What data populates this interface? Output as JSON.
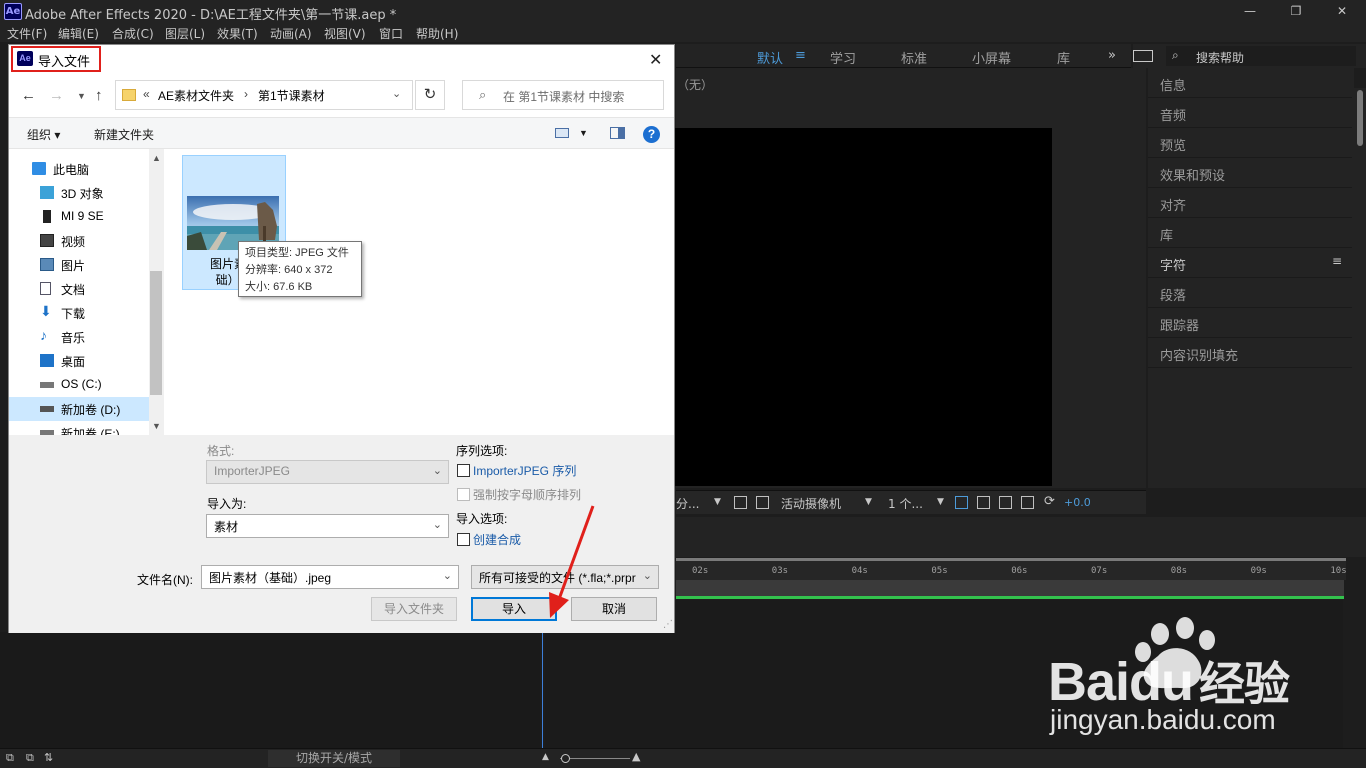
{
  "app": {
    "title": "Adobe After Effects 2020 - D:\\AE工程文件夹\\第一节课.aep *",
    "logo": "Ae",
    "menu": [
      "文件(F)",
      "编辑(E)",
      "合成(C)",
      "图层(L)",
      "效果(T)",
      "动画(A)",
      "视图(V)",
      "窗口",
      "帮助(H)"
    ],
    "workspaces": [
      "默认",
      "学习",
      "标准",
      "小屏幕",
      "库"
    ],
    "more_glyph": "»",
    "search_help": "搜索帮助",
    "viewer_label": "（无）",
    "viewer_toolbar": {
      "resolution": "分...",
      "camera": "活动摄像机",
      "views": "1 个...",
      "exposure": "+0.0"
    },
    "right_panel": [
      "信息",
      "音频",
      "预览",
      "效果和预设",
      "对齐",
      "库",
      "字符",
      "段落",
      "跟踪器",
      "内容识别填充"
    ],
    "timeline_ticks": [
      "02s",
      "03s",
      "04s",
      "05s",
      "06s",
      "07s",
      "08s",
      "09s",
      "10s"
    ],
    "toggle_modes": "切换开关/模式"
  },
  "dialog": {
    "title": "导入文件",
    "close_glyph": "✕",
    "breadcrumb": [
      "«",
      "AE素材文件夹",
      "›",
      "第1节课素材"
    ],
    "search_placeholder": "在 第1节课素材 中搜索",
    "toolbar": {
      "organize": "组织 ▾",
      "new_folder": "新建文件夹",
      "help": "?"
    },
    "nav": [
      {
        "label": "此电脑",
        "icon": "pc-icon"
      },
      {
        "label": "3D 对象",
        "icon": "3d-objects-icon"
      },
      {
        "label": "MI 9 SE",
        "icon": "phone-icon"
      },
      {
        "label": "视频",
        "icon": "video-icon"
      },
      {
        "label": "图片",
        "icon": "pictures-icon"
      },
      {
        "label": "文档",
        "icon": "documents-icon"
      },
      {
        "label": "下载",
        "icon": "download-icon"
      },
      {
        "label": "音乐",
        "icon": "music-icon"
      },
      {
        "label": "桌面",
        "icon": "desktop-icon"
      },
      {
        "label": "OS (C:)",
        "icon": "drive-icon"
      },
      {
        "label": "新加卷 (D:)",
        "icon": "drive-icon"
      },
      {
        "label": "新加卷 (E:)",
        "icon": "drive-icon"
      }
    ],
    "file": {
      "label_line1": "图片素材",
      "label_line2": "础）.jp",
      "tooltip": [
        "项目类型: JPEG 文件",
        "分辨率: 640 x 372",
        "大小: 67.6 KB"
      ]
    },
    "format_label": "格式:",
    "format_value": "ImporterJPEG",
    "import_as_label": "导入为:",
    "import_as_value": "素材",
    "sequence_options_label": "序列选项:",
    "sequence_checkbox": "ImporterJPEG 序列",
    "alpha_sort_checkbox": "强制按字母顺序排列",
    "import_options_label": "导入选项:",
    "create_comp_checkbox": "创建合成",
    "filename_label": "文件名(N):",
    "filename_value": "图片素材（基础）.jpeg",
    "filter_value": "所有可接受的文件 (*.fla;*.prpr",
    "import_folder_button": "导入文件夹",
    "import_button": "导入",
    "cancel_button": "取消"
  },
  "watermark": {
    "brand": "Bai",
    "brand2": "du",
    "cn": "经验",
    "url": "jingyan.baidu.com"
  },
  "colors": {
    "ae_blue": "#4d9bd9",
    "annotation_red": "#e0201b",
    "win_accent": "#0078d7",
    "timeline_green": "#33c24d"
  }
}
